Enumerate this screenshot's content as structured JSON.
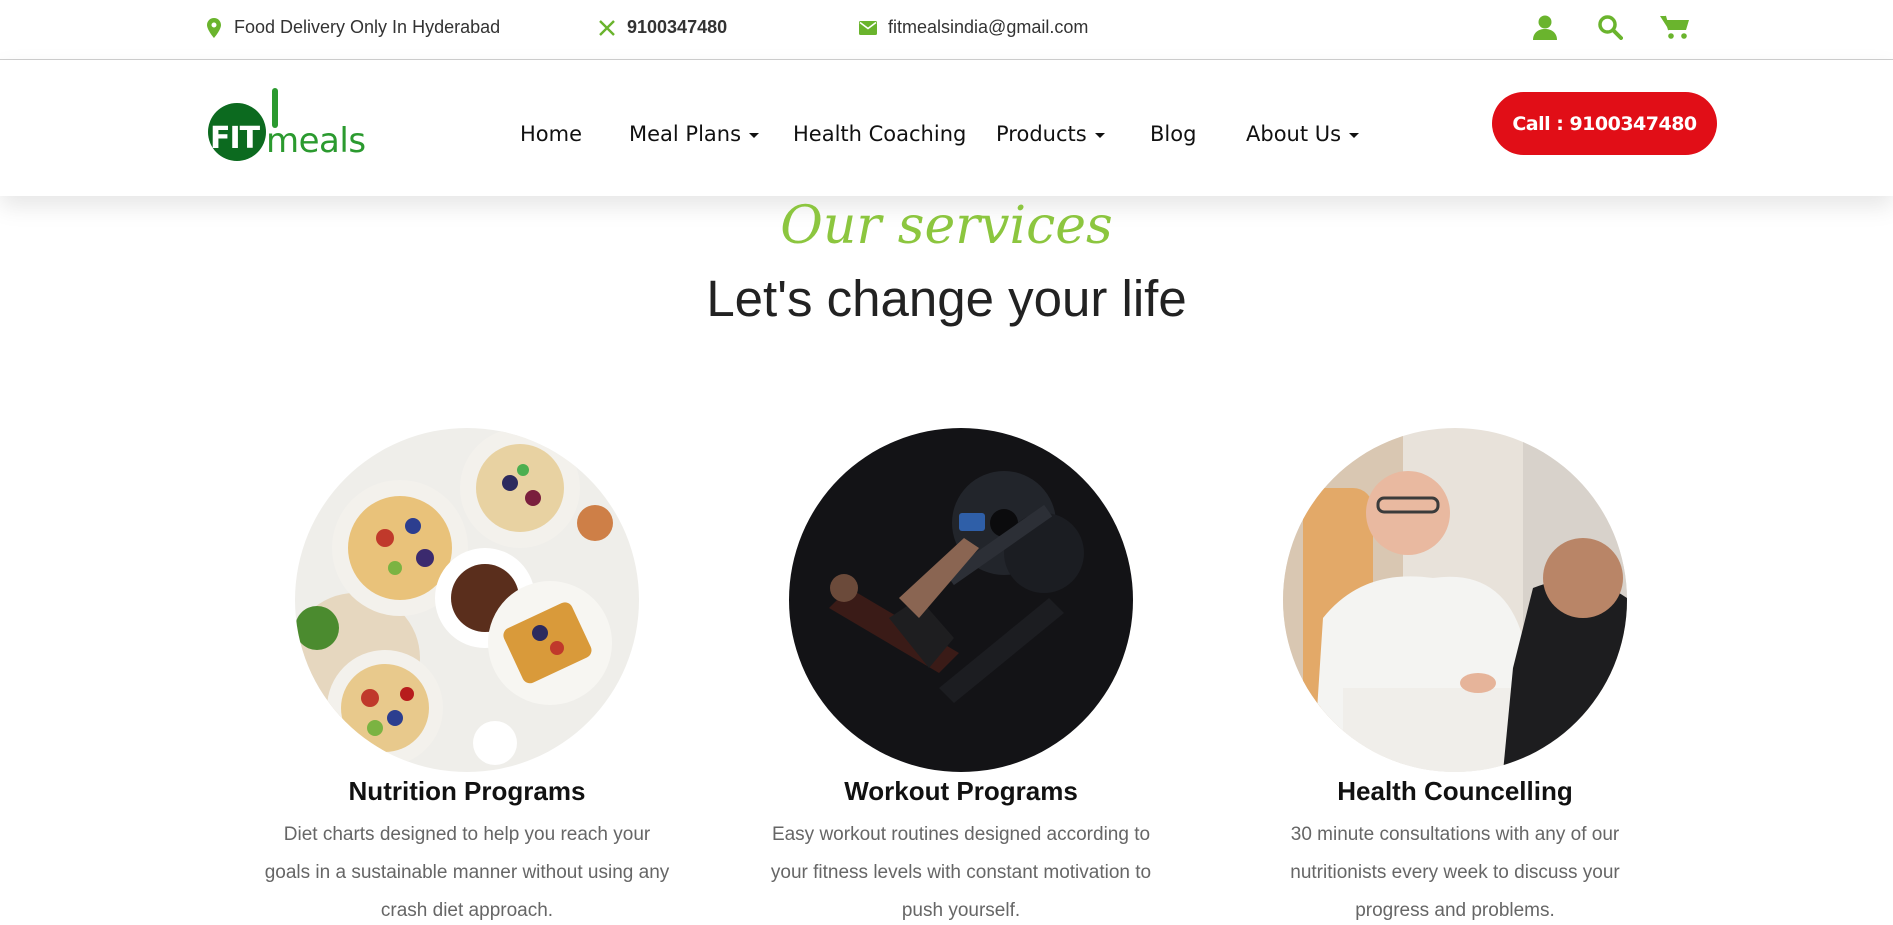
{
  "topbar": {
    "location": "Food Delivery Only In Hyderabad",
    "phone": "9100347480",
    "email": "fitmealsindia@gmail.com",
    "icons": [
      "user-icon",
      "search-icon",
      "cart-icon"
    ]
  },
  "logo": {
    "fit": "FIT",
    "meals": "meals"
  },
  "nav": {
    "home": "Home",
    "meal_plans": "Meal Plans",
    "health_coaching": "Health Coaching",
    "products": "Products",
    "blog": "Blog",
    "about": "About Us"
  },
  "call_button": "Call : 9100347480",
  "services": {
    "eyebrow": "Our services",
    "title": "Let's change your life",
    "cards": [
      {
        "title": "Nutrition Programs",
        "description": "Diet charts designed to help you reach your goals in a sustainable manner without using any crash diet approach."
      },
      {
        "title": "Workout Programs",
        "description": "Easy workout routines designed according to your fitness levels with constant motivation to push yourself."
      },
      {
        "title": "Health Councelling",
        "description": "30 minute consultations with any of our nutritionists every week to discuss your progress and problems."
      }
    ]
  },
  "colors": {
    "brand_green": "#8cc63f",
    "icon_green": "#6ab42d",
    "call_red": "#e10e17",
    "logo_dark_green": "#0c6a1f"
  }
}
